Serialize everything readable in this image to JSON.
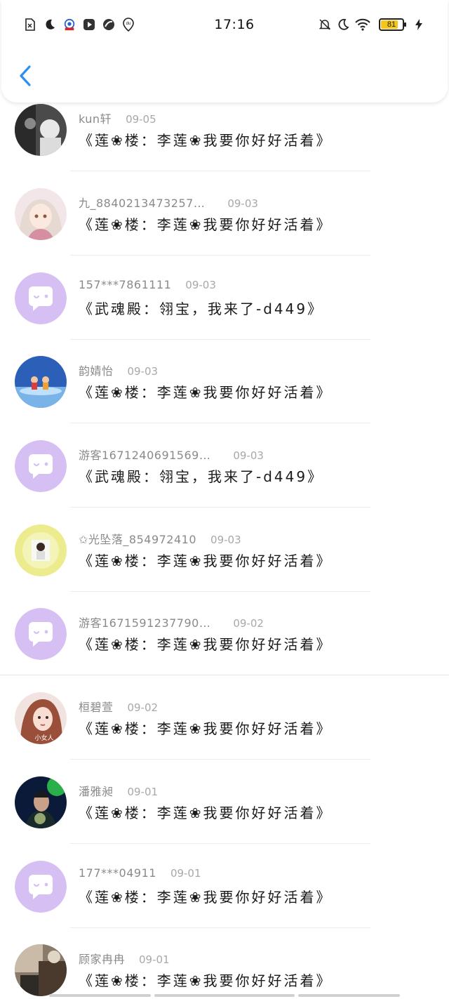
{
  "status_bar": {
    "time": "17:16",
    "battery_level": "81",
    "battery_fraction": 0.81,
    "left_icons": [
      "sim-off-icon",
      "moon-icon",
      "bank-app-icon",
      "video-app-icon",
      "browser-app-icon",
      "location-pin-icon"
    ],
    "right_icons": [
      "bell-off-icon",
      "moon-icon",
      "wifi-icon",
      "battery-icon",
      "charging-bolt-icon"
    ]
  },
  "nav": {
    "back_icon": "chevron-left-icon",
    "accent_color": "#2b8ef0"
  },
  "avatar_placeholder_color": "#d6bff2",
  "items": [
    {
      "name": "kun轩",
      "date": "09-05",
      "message": "《莲❀楼：李莲❀我要你好好活着》",
      "avatar": "photo-dark"
    },
    {
      "name": "九_8840213473257…",
      "date": "09-03",
      "message": "《莲❀楼：李莲❀我要你好好活着》",
      "avatar": "anime-girl"
    },
    {
      "name": "157***7861111",
      "date": "09-03",
      "message": "《武魂殿：翎宝，我来了-d449》",
      "avatar": "default"
    },
    {
      "name": "韵婧怡",
      "date": "09-03",
      "message": "《莲❀楼：李莲❀我要你好好活着》",
      "avatar": "blue-scene"
    },
    {
      "name": "游客1671240691569…",
      "date": "09-03",
      "message": "《武魂殿：翎宝，我来了-d449》",
      "avatar": "default"
    },
    {
      "name": "✩光坠落_854972410",
      "date": "09-03",
      "message": "《莲❀楼：李莲❀我要你好好活着》",
      "avatar": "yellow-girl"
    },
    {
      "name": "游客1671591237790…",
      "date": "09-02",
      "message": "《莲❀楼：李莲❀我要你好好活着》",
      "avatar": "default"
    },
    {
      "name": "桓碧萱",
      "date": "09-02",
      "message": "《莲❀楼：李莲❀我要你好好活着》",
      "avatar": "girl-portrait",
      "avatar_caption": "小女人"
    },
    {
      "name": "潘雅昶",
      "date": "09-01",
      "message": "《莲❀楼：李莲❀我要你好好活着》",
      "avatar": "green-neon"
    },
    {
      "name": "177***04911",
      "date": "09-01",
      "message": "《莲❀楼：李莲❀我要你好好活着》",
      "avatar": "default"
    },
    {
      "name": "顾家冉冉",
      "date": "09-01",
      "message": "《莲❀楼：李莲❀我要你好好活着》",
      "avatar": "room-photo"
    }
  ]
}
